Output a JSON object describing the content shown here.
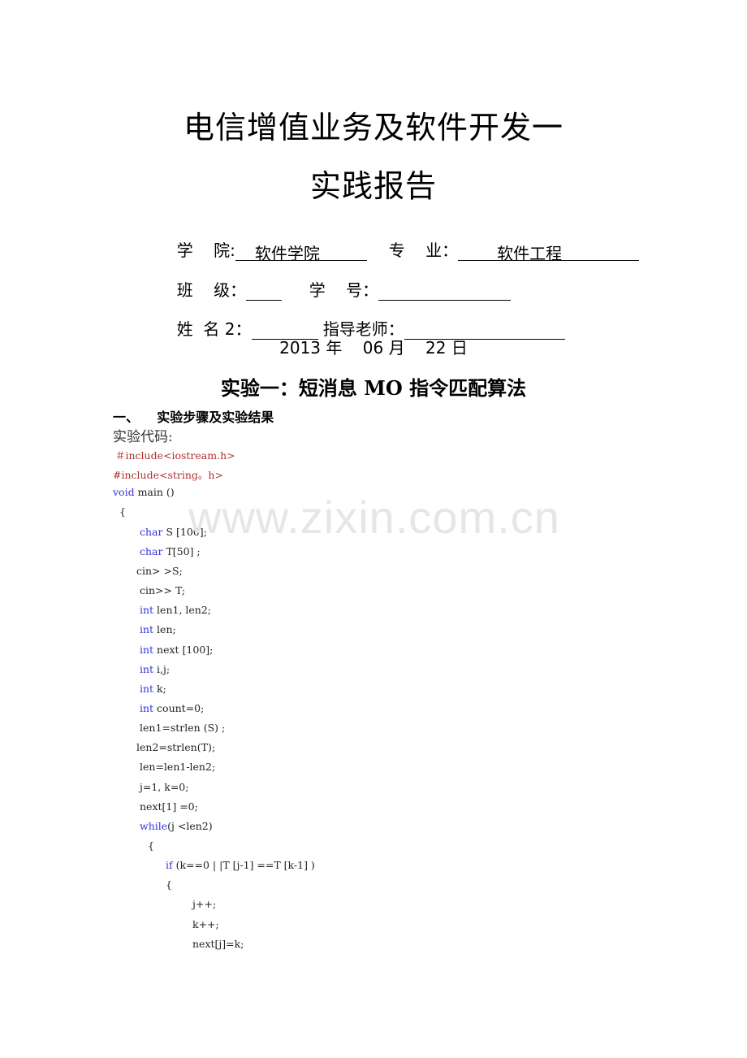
{
  "document": {
    "title_line1": "电信增值业务及软件开发一",
    "title_line2": "实践报告",
    "info": {
      "college_label": "学    院:",
      "college_value": "软件学院",
      "major_label": "专    业：",
      "major_value": "软件工程",
      "class_label": "班    级：",
      "class_value": "",
      "student_id_label": "学    号：",
      "student_id_value": "",
      "name_label": "姓  名 2：",
      "name_value": "",
      "advisor_label": "指导老师：",
      "advisor_value": ""
    },
    "date": "2013 年    06 月    22 日",
    "experiment_title": "实验一：短消息 MO 指令匹配算法",
    "section_heading": "一、    实验步骤及实验结果",
    "code_label": "实验代码:",
    "code_lines": [
      {
        "indent": 0,
        "parts": [
          {
            "t": "＃include<iostream.h>",
            "c": "pp"
          }
        ]
      },
      {
        "indent": 0,
        "parts": [
          {
            "t": "#include<string。h>",
            "c": "pp"
          }
        ]
      },
      {
        "indent": 0,
        "parts": [
          {
            "t": "void",
            "c": "kw"
          },
          {
            "t": " main ()",
            "c": ""
          }
        ]
      },
      {
        "indent": 0,
        "parts": [
          {
            "t": " {",
            "c": ""
          }
        ]
      },
      {
        "indent": 1,
        "parts": [
          {
            "t": "char",
            "c": "kw"
          },
          {
            "t": " S [100];",
            "c": ""
          }
        ]
      },
      {
        "indent": 1,
        "parts": [
          {
            "t": "char",
            "c": "kw"
          },
          {
            "t": " T[50] ;",
            "c": ""
          }
        ]
      },
      {
        "indent": 1,
        "parts": [
          {
            "t": "cin> >S;",
            "c": ""
          }
        ]
      },
      {
        "indent": 1,
        "parts": [
          {
            "t": "cin>> T;",
            "c": ""
          }
        ]
      },
      {
        "indent": 1,
        "parts": [
          {
            "t": "int",
            "c": "kw"
          },
          {
            "t": " len1, len2;",
            "c": ""
          }
        ]
      },
      {
        "indent": 1,
        "parts": [
          {
            "t": "int",
            "c": "kw"
          },
          {
            "t": " len;",
            "c": ""
          }
        ]
      },
      {
        "indent": 1,
        "parts": [
          {
            "t": "int",
            "c": "kw"
          },
          {
            "t": " next [100];",
            "c": ""
          }
        ]
      },
      {
        "indent": 1,
        "parts": [
          {
            "t": "int",
            "c": "kw"
          },
          {
            "t": " i,j;",
            "c": ""
          }
        ]
      },
      {
        "indent": 1,
        "parts": [
          {
            "t": "int",
            "c": "kw"
          },
          {
            "t": " k;",
            "c": ""
          }
        ]
      },
      {
        "indent": 1,
        "parts": [
          {
            "t": "int",
            "c": "kw"
          },
          {
            "t": " count=0;",
            "c": ""
          }
        ]
      },
      {
        "indent": 1,
        "parts": [
          {
            "t": "len1=strlen (S) ;",
            "c": ""
          }
        ]
      },
      {
        "indent": 1,
        "parts": [
          {
            "t": "len2=strlen(T);",
            "c": ""
          }
        ]
      },
      {
        "indent": 1,
        "parts": [
          {
            "t": "len=len1-len2;",
            "c": ""
          }
        ]
      },
      {
        "indent": 1,
        "parts": [
          {
            "t": "j=1, k=0;",
            "c": ""
          }
        ]
      },
      {
        "indent": 1,
        "parts": [
          {
            "t": "next[1] =0;",
            "c": ""
          }
        ]
      },
      {
        "indent": 1,
        "parts": [
          {
            "t": "while",
            "c": "kw"
          },
          {
            "t": "(j <len2)",
            "c": ""
          }
        ]
      },
      {
        "indent": 1,
        "parts": [
          {
            "t": " {",
            "c": ""
          }
        ]
      },
      {
        "indent": 2,
        "parts": [
          {
            "t": "if",
            "c": "kw"
          },
          {
            "t": " (k==0 | |T [j-1] ==T [k-1] )",
            "c": ""
          }
        ]
      },
      {
        "indent": 2,
        "parts": [
          {
            "t": "{",
            "c": ""
          }
        ]
      },
      {
        "indent": 3,
        "parts": [
          {
            "t": "j++;",
            "c": ""
          }
        ]
      },
      {
        "indent": 3,
        "parts": [
          {
            "t": "k++;",
            "c": ""
          }
        ]
      },
      {
        "indent": 3,
        "parts": [
          {
            "t": "next[j]=k;",
            "c": ""
          }
        ]
      }
    ],
    "watermark": "www.zixin.com.cn"
  }
}
